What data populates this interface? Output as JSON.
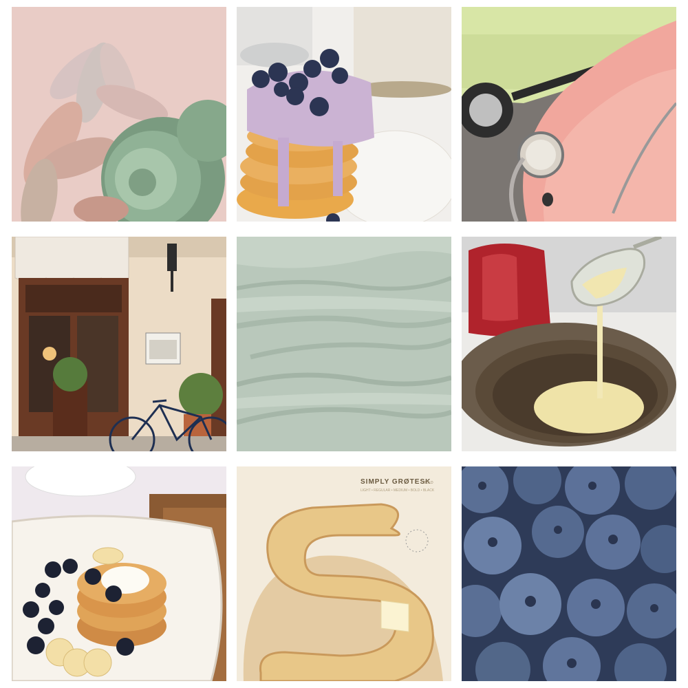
{
  "grid": {
    "tiles": [
      {
        "subject": "succulent plants on pink background"
      },
      {
        "subject": "pancake stack with blueberry yogurt"
      },
      {
        "subject": "pastel green and pink vintage cars"
      },
      {
        "subject": "cafe storefront with bicycle"
      },
      {
        "subject": "sage green frosting texture"
      },
      {
        "subject": "batter poured into frying pan"
      },
      {
        "subject": "pancakes with blueberries and banana"
      },
      {
        "subject": "pancake shaped like letter S with butter"
      },
      {
        "subject": "close-up of blueberries"
      }
    ]
  },
  "typography_ad": {
    "brand": "SIMPLY GRØTESK",
    "sub_small": "BOLD",
    "weights": "LIGHT • REGULAR • MEDIUM • BOLD • BLACK"
  },
  "colors": {
    "pink_bg": "#e9cbc4",
    "sage": "#b9c8bb",
    "red_kettle": "#b0232c",
    "blueberry": "#4a5f85",
    "cream": "#f3ebdc"
  }
}
